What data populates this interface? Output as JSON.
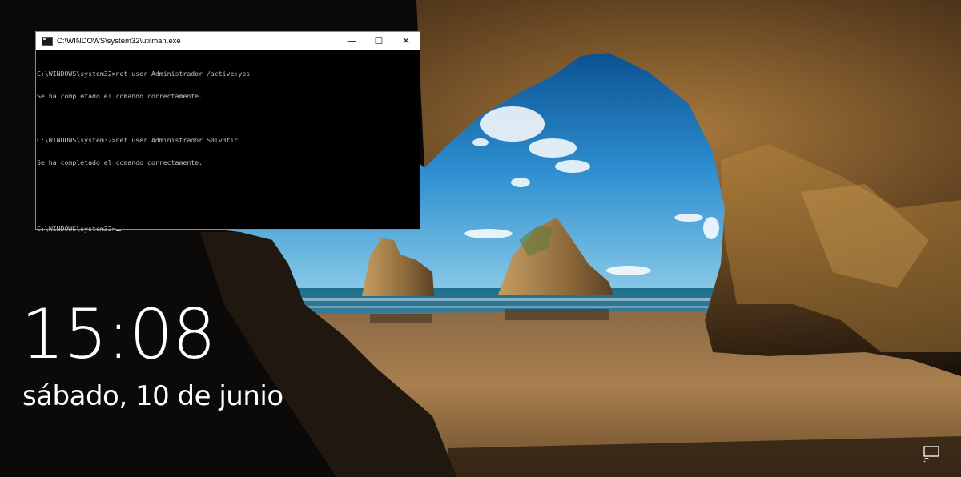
{
  "window": {
    "title": "C:\\WINDOWS\\system32\\utilman.exe",
    "minimize_glyph": "—",
    "maximize_glyph": "☐",
    "close_glyph": "✕",
    "console_lines": [
      "C:\\WINDOWS\\system32>net user Administrador /active:yes",
      "Se ha completado el comando correctamente.",
      "",
      "C:\\WINDOWS\\system32>net user Administrador S0lv3tic",
      "Se ha completado el comando correctamente.",
      "",
      "",
      "C:\\WINDOWS\\system32>"
    ]
  },
  "lockscreen": {
    "time": "15:08",
    "date": "sábado, 10 de junio",
    "network_icon": "display-network-icon"
  },
  "colors": {
    "console_bg": "#000000",
    "console_text": "#c0c0c0",
    "clock_text": "#ffffff"
  }
}
